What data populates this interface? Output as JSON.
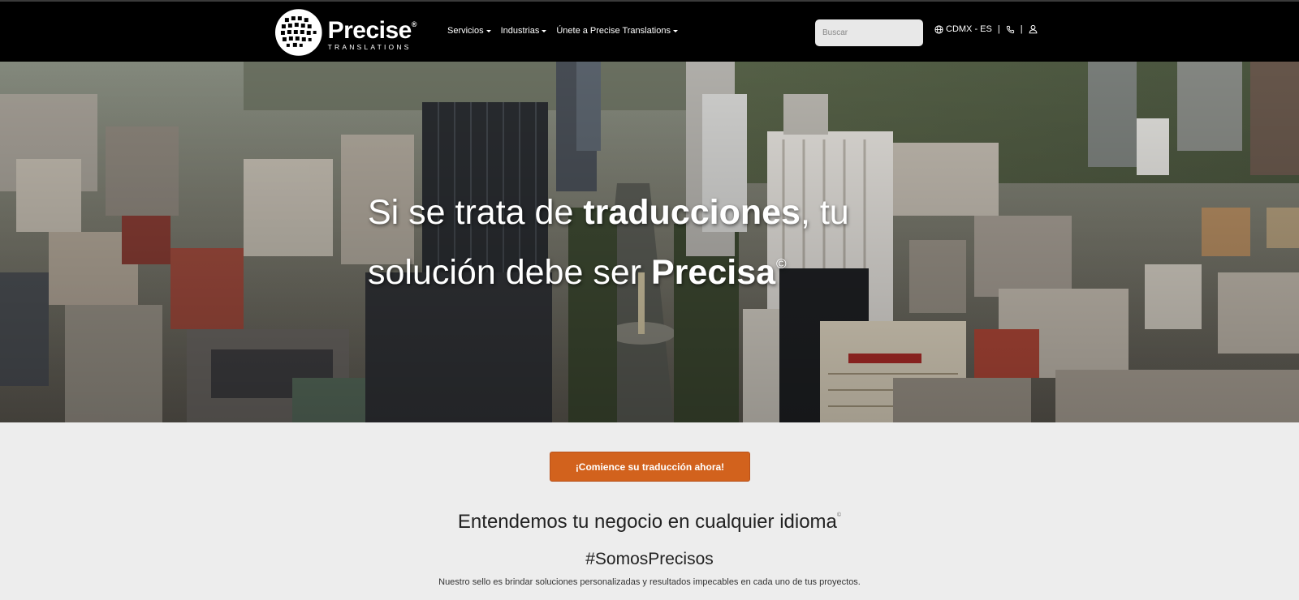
{
  "header": {
    "logo": {
      "name": "Precise",
      "sub": "TRANSLATIONS",
      "trademark": "®"
    },
    "nav": [
      {
        "label": "Servicios"
      },
      {
        "label": "Industrias"
      },
      {
        "label": "Únete a Precise Translations"
      }
    ],
    "search": {
      "placeholder": "Buscar",
      "value": ""
    },
    "utility": {
      "globe_icon": "globe-icon",
      "locale": "CDMX - ES",
      "separator": "|",
      "phone_icon": "phone-icon",
      "user_icon": "user-icon"
    }
  },
  "hero": {
    "line1_pre": "Si se trata de ",
    "line1_bold": "traducciones",
    "line1_post": ", tu",
    "line2_pre": "solución debe ser ",
    "line2_bold": "Precisa",
    "mark": "©"
  },
  "cta": {
    "label": "¡Comience su traducción ahora!"
  },
  "content": {
    "tagline": "Entendemos tu negocio en cualquier idioma",
    "tagline_mark": "©",
    "hashtag": "#SomosPrecisos",
    "description": "Nuestro sello es brindar soluciones personalizadas y resultados impecables en cada uno de tus proyectos."
  },
  "colors": {
    "navbar": "#000000",
    "accent": "#d2621d",
    "page_bg": "#ededed"
  }
}
